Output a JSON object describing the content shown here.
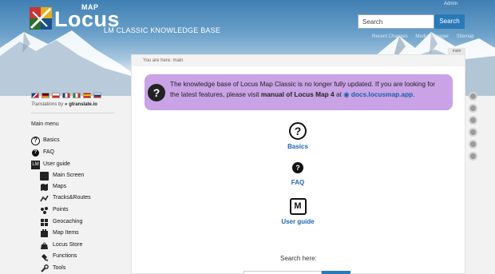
{
  "header": {
    "logo_word": "Locus",
    "logo_sup": "MAP",
    "subtitle": "LM CLASSIC KNOWLEDGE BASE",
    "admin": "Admin",
    "search_placeholder": "Search",
    "search_button": "Search",
    "links": [
      "Recent Changes",
      "Media Manager",
      "Sitemap"
    ]
  },
  "page_tab": "main",
  "breadcrumb": "You are here: main",
  "notice": {
    "text1": "The knowledge base of Locus Map Classic is no longer fully updated. If you are looking for the latest features, please visit ",
    "bold": "manual of Locus Map 4",
    "text2": " at ",
    "link": "docs.locusmap.app",
    "end": "."
  },
  "quick_links": [
    {
      "label": "Basics",
      "icon": "question-circle-icon"
    },
    {
      "label": "FAQ",
      "icon": "question-filled-icon"
    },
    {
      "label": "User guide",
      "icon": "manual-book-icon"
    }
  ],
  "search_here": "Search here:",
  "sidebar": {
    "translations_prefix": "Translations by",
    "translations_brand": "gtranslate.io",
    "menu_title": "Main menu",
    "top_items": [
      {
        "label": "Basics",
        "icon": "question-circle-icon"
      },
      {
        "label": "FAQ",
        "icon": "question-filled-icon"
      },
      {
        "label": "User guide",
        "icon": "manual-book-icon"
      }
    ],
    "sub_items": [
      {
        "label": "Main Screen",
        "icon": "main-screen-icon"
      },
      {
        "label": "Maps",
        "icon": "map-icon"
      },
      {
        "label": "Tracks&Routes",
        "icon": "track-icon"
      },
      {
        "label": "Points",
        "icon": "points-icon"
      },
      {
        "label": "Geocaching",
        "icon": "geocache-icon"
      },
      {
        "label": "Map Items",
        "icon": "map-items-icon"
      },
      {
        "label": "Locus Store",
        "icon": "store-icon"
      },
      {
        "label": "Functions",
        "icon": "functions-icon"
      },
      {
        "label": "Tools",
        "icon": "tools-icon"
      }
    ]
  },
  "flags": [
    "English",
    "German",
    "Czech",
    "French",
    "Italian",
    "Spanish",
    "Russian"
  ],
  "colors": {
    "accent": "#2a7ab8",
    "notice_bg": "#c9a3e6",
    "link": "#1d66b0"
  }
}
